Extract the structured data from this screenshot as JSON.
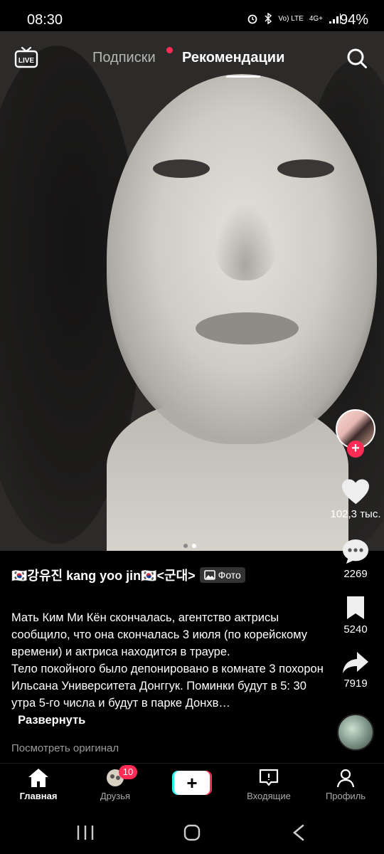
{
  "status_bar": {
    "time": "08:30",
    "network": "Vo) LTE",
    "signal_type": "4G+",
    "battery": "94%"
  },
  "top_nav": {
    "live_label": "LIVE",
    "tab_following": "Подписки",
    "tab_for_you": "Рекомендации"
  },
  "post": {
    "author": "🇰🇷강유진 kang yoo jin🇰🇷<군대>",
    "badge": "Фото",
    "caption": "Мать Ким Ми Кён скончалась, агентство актрисы сообщило, что она скончалась 3 июля (по корейскому времени) и актриса находится в трауре.\nТело покойного было депонировано в комнате 3 похорон Ильсана Университета Донггук. Поминки будут в 5: 30 утра 5-го числа и будут в парке Донхв…",
    "expand_label": "Развернуть",
    "view_original": "Посмотреть оригинал",
    "slides_total": 2,
    "slide_active": 2
  },
  "actions": {
    "likes": "102,3 тыс.",
    "comments": "2269",
    "saves": "5240",
    "shares": "7919"
  },
  "bottom_nav": {
    "home": "Главная",
    "friends": "Друзья",
    "friends_badge": "10",
    "inbox": "Входящие",
    "profile": "Профиль"
  },
  "colors": {
    "accent": "#fe2c55",
    "accent_cyan": "#25f4ee"
  }
}
